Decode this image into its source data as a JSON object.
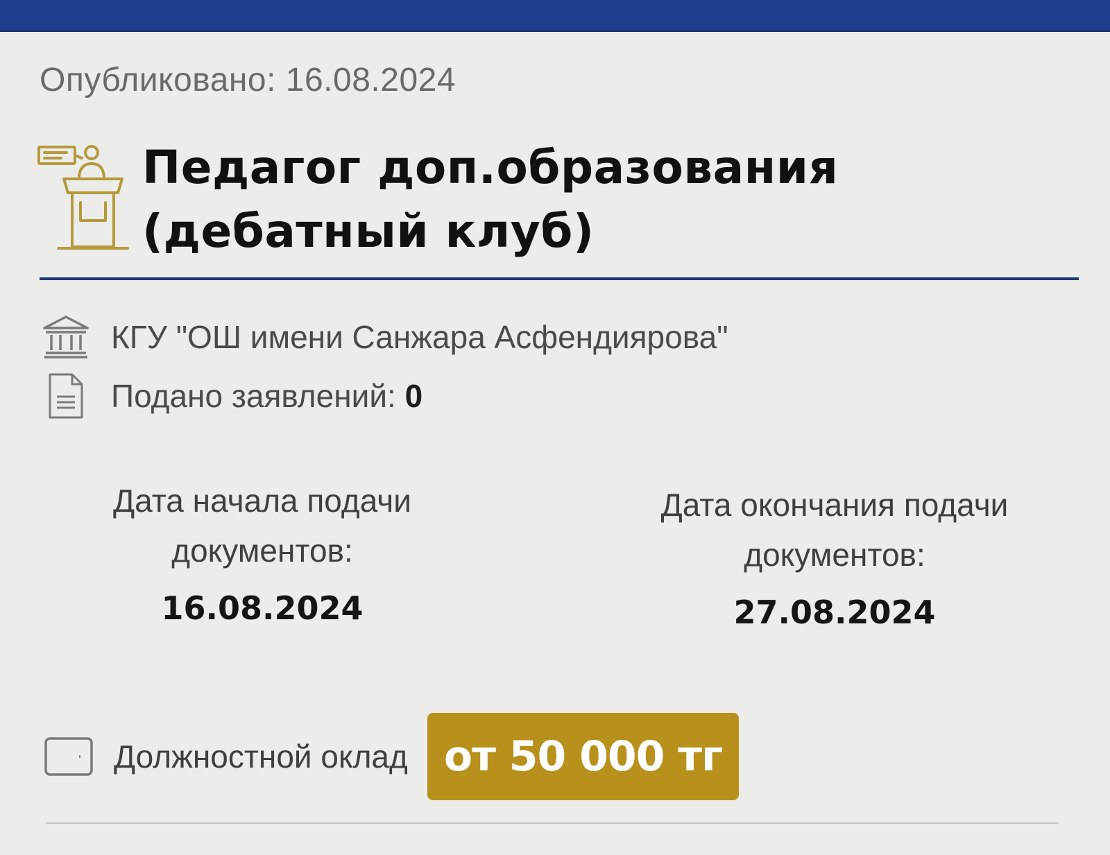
{
  "published": "Опубликовано: 16.08.2024",
  "title": "Педагог доп.образования (дебатный клуб)",
  "organization": "КГУ \"ОШ имени Санжара Асфендиярова\"",
  "applications": {
    "label": "Подано заявлений:",
    "count": "0"
  },
  "dates": {
    "start_label": "Дата начала подачи документов:",
    "start_value": "16.08.2024",
    "end_label": "Дата окончания подачи документов:",
    "end_value": "27.08.2024"
  },
  "salary": {
    "label": "Должностной оклад",
    "value": "от 50 000 тг"
  },
  "colors": {
    "header": "#1e3f8c",
    "divider": "#1f3a72",
    "accent_gold": "#b8911c",
    "background": "#ececea"
  },
  "icons": {
    "title": "teacher-podium-icon",
    "organization": "institution-building-icon",
    "applications": "document-icon",
    "salary": "wallet-icon"
  }
}
